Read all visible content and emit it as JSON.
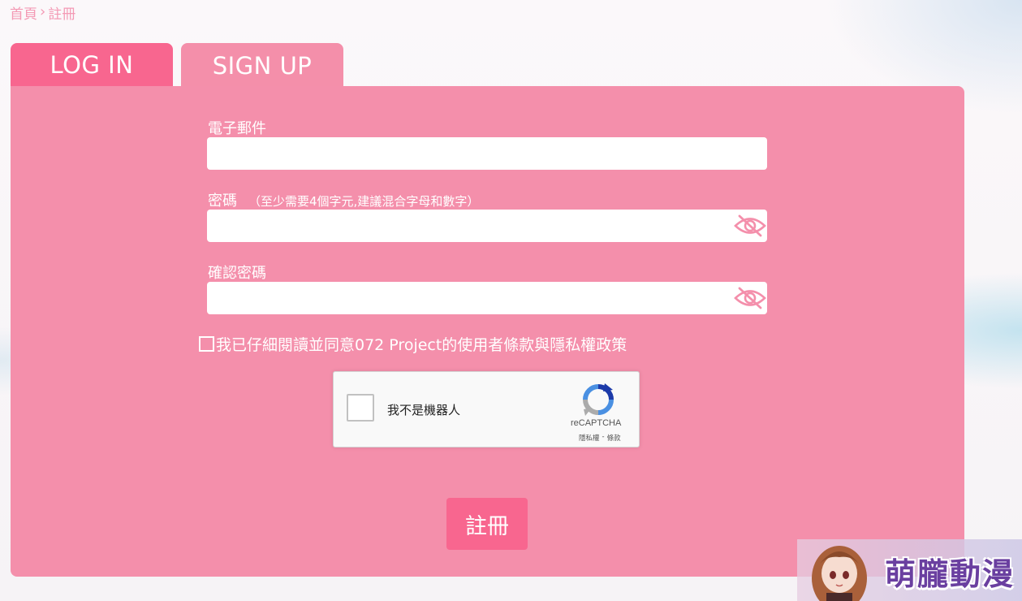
{
  "breadcrumb": {
    "home": "首頁",
    "separator": "›",
    "current": "註冊"
  },
  "tabs": {
    "login": "LOG IN",
    "signup": "SIGN UP"
  },
  "form": {
    "email_label": "電子郵件",
    "password_label": "密碼",
    "password_hint": "（至少需要4個字元,建議混合字母和數字）",
    "confirm_label": "確認密碼",
    "agree_text": "我已仔細閱讀並同意072 Project的使用者條款與隱私權政策",
    "submit_label": "註冊"
  },
  "captcha": {
    "label": "我不是機器人",
    "brand": "reCAPTCHA",
    "privacy": "隱私權",
    "terms_sep": "-",
    "terms": "條款"
  },
  "watermark": {
    "text": "萌朧動漫"
  },
  "colors": {
    "panel": "#f48fab",
    "accent": "#f8668f",
    "breadcrumb": "#f49ab5"
  },
  "icons": {
    "password_toggle": "eye-slash-icon",
    "captcha_logo": "recaptcha-logo"
  }
}
